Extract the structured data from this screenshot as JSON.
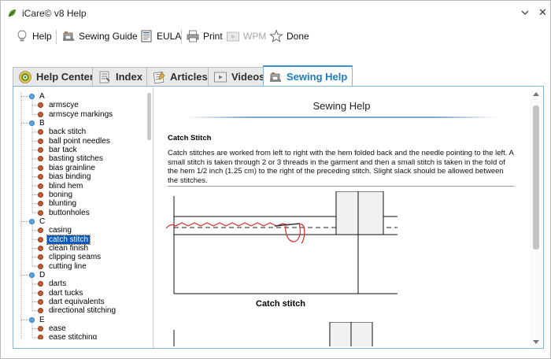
{
  "window": {
    "title": "iCare© v8 Help"
  },
  "toolbar": {
    "help": "Help",
    "sewing_guide": "Sewing Guide",
    "eula": "EULA",
    "print": "Print",
    "wpm": "WPM",
    "done": "Done"
  },
  "tabs": [
    {
      "label": "Help Center",
      "icon": "target-icon"
    },
    {
      "label": "Index",
      "icon": "index-icon"
    },
    {
      "label": "Articles",
      "icon": "articles-icon"
    },
    {
      "label": "Videos",
      "icon": "film-icon"
    },
    {
      "label": "Sewing Help",
      "icon": "sewing-machine-icon",
      "active": true
    }
  ],
  "tree": {
    "groups": [
      {
        "letter": "A",
        "items": [
          "armscye",
          "armscye markings"
        ]
      },
      {
        "letter": "B",
        "items": [
          "back stitch",
          "ball point needles",
          "bar tack",
          "basting stitches",
          "bias grainline",
          "bias binding",
          "blind hem",
          "boning",
          "blunting",
          "buttonholes"
        ]
      },
      {
        "letter": "C",
        "items": [
          "casing",
          "catch stitch",
          "clean finish",
          "clipping seams",
          "cutting line"
        ]
      },
      {
        "letter": "D",
        "items": [
          "darts",
          "dart tucks",
          "dart equivalents",
          "directional stitching"
        ]
      },
      {
        "letter": "E",
        "items": [
          "ease",
          "ease stitching"
        ]
      }
    ],
    "selected": "catch stitch"
  },
  "content": {
    "page_title": "Sewing Help",
    "section_heading": "Catch Stitch",
    "paragraph": "Catch stitches are worked from left to right with the hem folded back and the needle pointing to the left. A small stitch is taken through 2 or 3 threads in the garment and then a small stitch is taken in the fold of the hem 1/2 inch (1.25 cm) to the right of the preceding stitch. Slight slack should be allowed between the stitches.",
    "figure_caption": "Catch stitch"
  },
  "colors": {
    "accent": "#1c7fc0",
    "selection": "#0a58c2",
    "thread": "#d62b2b",
    "tree_leaf": "#c9592f",
    "tree_node": "#5aa6e0"
  }
}
